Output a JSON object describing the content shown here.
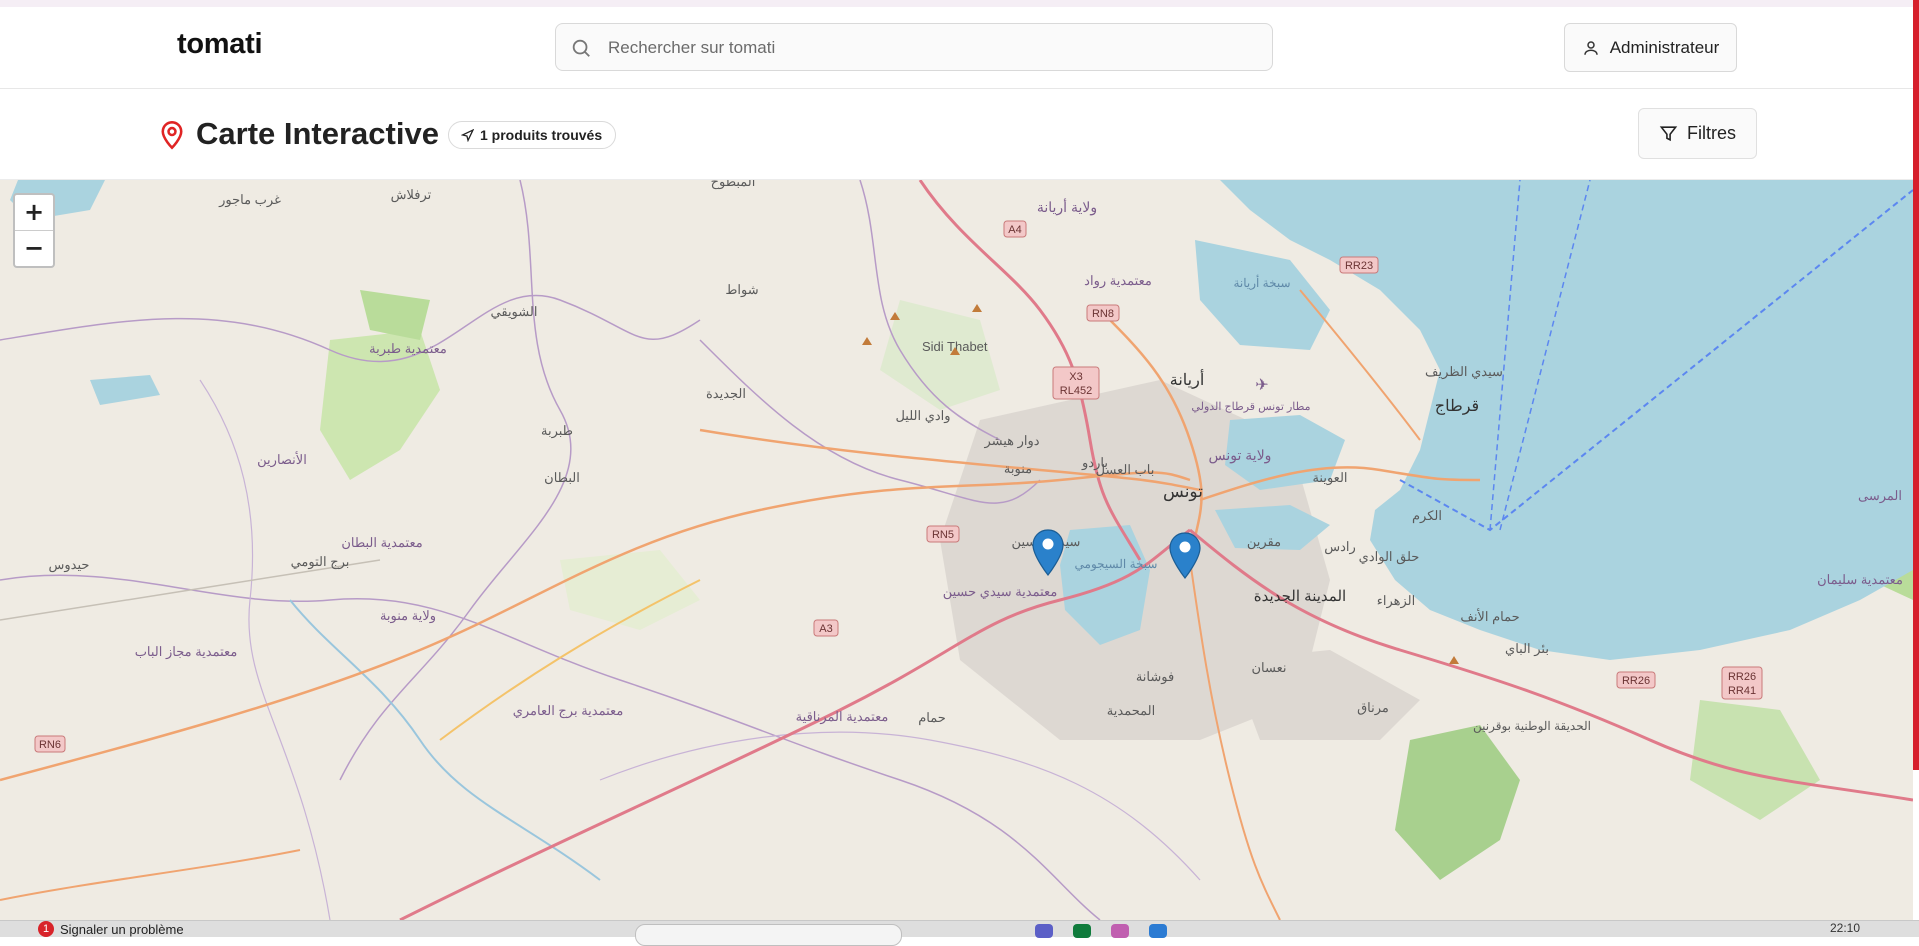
{
  "header": {
    "brand": "tomati",
    "search_placeholder": "Rechercher sur tomati",
    "user_button": "Administrateur"
  },
  "subheader": {
    "title": "Carte Interactive",
    "result_count": "1 produits trouvés",
    "filters_button": "Filtres"
  },
  "map": {
    "zoom_in": "+",
    "zoom_out": "−",
    "labels": {
      "aryana_gov": "ولاية أريانة",
      "sidi_thabet": "Sidi Thabet",
      "raoued": "معتمدية رواد",
      "aryana": "أريانة",
      "sidi_bou_said": "سيدي الظريف",
      "carthage": "قرطاج",
      "laouina": "العوينة",
      "airport": "مطار تونس قرطاج الدولي",
      "kram": "الكرم",
      "halq_el_oued": "حلق الوادي",
      "tunis_gov": "ولاية تونس",
      "tunis": "تونس",
      "bardo": "باردو",
      "bab_el_assal": "باب العسل",
      "manouba": "منوبة",
      "den_den": "دوار هيشر",
      "oued_ellil": "وادي الليل",
      "jedeida": "الجديدة",
      "tebourba": "طبربة",
      "battan": "البطان",
      "chouigui": "الشويقي",
      "tebourba_del": "معتمدية طبربة",
      "ansarine": "الأنصارين",
      "battan_del": "معتمدية البطان",
      "bordj_toumi": "برج التومي",
      "heydous": "حيدوس",
      "mejez": "معتمدية مجاز الباب",
      "manouba_gov": "ولاية منوبة",
      "mornaguia": "معتمدية المرناقية",
      "bordj_amri": "معتمدية برج العامري",
      "sidi_hassine": "سيدي حسين",
      "sidi_hassine_del": "معتمدية سيدي حسين",
      "sebkha_sijoumi": "سبخة السيجومي",
      "medina_jedida": "المدينة الجديدة",
      "megrine": "مقرين",
      "rades": "رادس",
      "zahra": "الزهراء",
      "hammam_lif": "حمام الأنف",
      "bir_el_bey": "بئر الباي",
      "naassen": "نعسان",
      "fouchana": "فوشانة",
      "mohamedia": "المحمدية",
      "mornag": "مرناق",
      "soliman": "معتمدية سليمان",
      "marsa": "المرسى",
      "national_park": "الحديقة الوطنية بوقرنين",
      "mabtouha": "المبطوح",
      "tarfalach": "ترفلاش",
      "gharb_majour": "غرب ماجور",
      "chouat": "شواط",
      "sebkha_ariana": "سبخة أريانة",
      "hama": "حمام",
      "ras": "الجديدة"
    },
    "road_shields": {
      "a4": "A4",
      "rn8": "RN8",
      "x3": "X3",
      "rl452": "RL452",
      "rr23": "RR23",
      "rn5": "RN5",
      "a3": "A3",
      "rn6": "RN6",
      "rr26": "RR26",
      "rr26b": "RR26",
      "rr41": "RR41"
    }
  },
  "taskbar": {
    "notice_count": "1",
    "notice_text": "Signaler un problème",
    "clock": "22:10"
  },
  "colors": {
    "accent_red": "#e02424",
    "marker_blue": "#2a81cb",
    "sea": "#aad3df"
  }
}
